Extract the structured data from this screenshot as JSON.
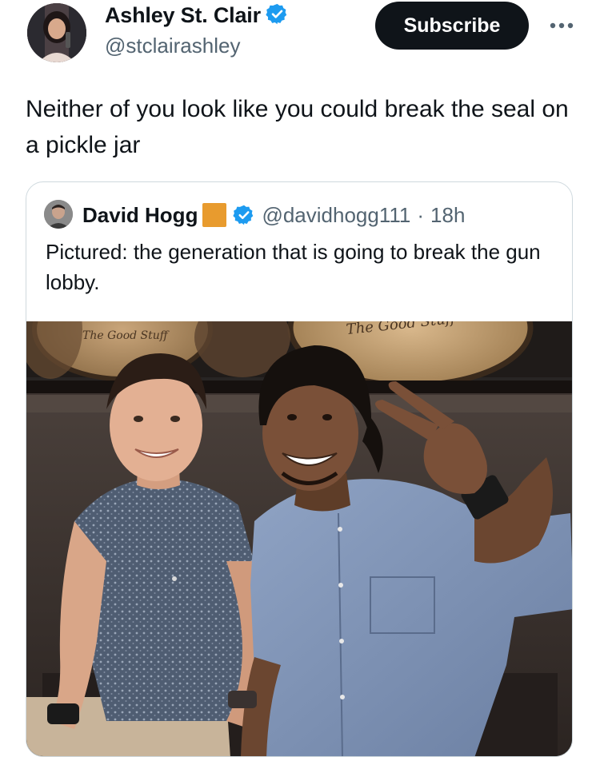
{
  "author": {
    "name": "Ashley St. Clair",
    "handle": "@stclairashley",
    "verified_icon": "verified-badge-icon"
  },
  "actions": {
    "subscribe_label": "Subscribe",
    "more_icon": "more-options-icon"
  },
  "tweet": {
    "text": "Neither of you look like you could break the seal on a pickle jar"
  },
  "quoted_tweet": {
    "author_name": "David Hogg",
    "handle": "@davidhogg111",
    "separator": "·",
    "time": "18h",
    "text": "Pictured: the generation that is going to break the gun lobby.",
    "badge_color": "#e89b2e"
  },
  "photo": {
    "barrel_text_left": "The Good Stuff",
    "barrel_text_right": "The Good Stuff"
  },
  "colors": {
    "accent_verified": "#1d9bf0",
    "text_primary": "#0f1419",
    "text_secondary": "#536471",
    "button_bg": "#0f1419"
  }
}
